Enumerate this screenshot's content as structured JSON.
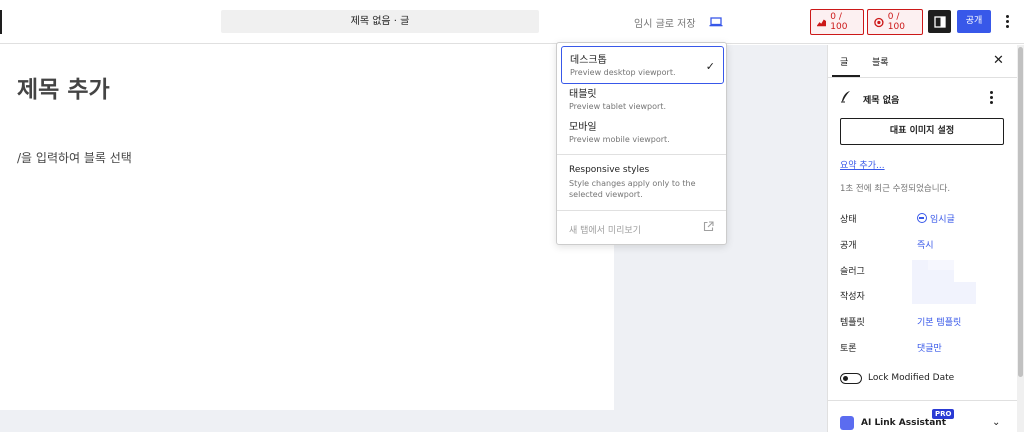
{
  "header": {
    "doc_title": "제목 없음 · 글",
    "save_draft": "임시 글로 저장",
    "score_seo": "0 / 100",
    "score_readability": "0 / 100",
    "publish": "공개"
  },
  "editor": {
    "post_title": "제목 추가",
    "block_hint": "/을 입력하여 블록 선택"
  },
  "preview_menu": {
    "items": [
      {
        "label": "데스크톱",
        "desc": "Preview desktop viewport.",
        "selected": true
      },
      {
        "label": "태블릿",
        "desc": "Preview tablet viewport."
      },
      {
        "label": "모바일",
        "desc": "Preview mobile viewport."
      }
    ],
    "responsive_title": "Responsive styles",
    "responsive_desc": "Style changes apply only to the selected viewport.",
    "new_tab": "새 탭에서 미리보기"
  },
  "sidebar": {
    "tabs": [
      "글",
      "블록"
    ],
    "post_title": "제목 없음",
    "featured_image": "대표 이미지 설정",
    "excerpt": "요약 추가...",
    "modified": "1초 전에 최근 수정되었습니다.",
    "rows": [
      {
        "label": "상태",
        "value": "임시글"
      },
      {
        "label": "공개",
        "value": "즉시"
      },
      {
        "label": "슬러그",
        "value": ""
      },
      {
        "label": "작성자",
        "value": ""
      },
      {
        "label": "템플릿",
        "value": "기본 템플릿"
      },
      {
        "label": "토론",
        "value": "댓글만"
      }
    ],
    "lock_modified": "Lock Modified Date",
    "ai_panel": "AI Link Assistant",
    "ai_badge": "PRO"
  },
  "colors": {
    "accent": "#3858e9",
    "score_red": "#cc1818"
  }
}
